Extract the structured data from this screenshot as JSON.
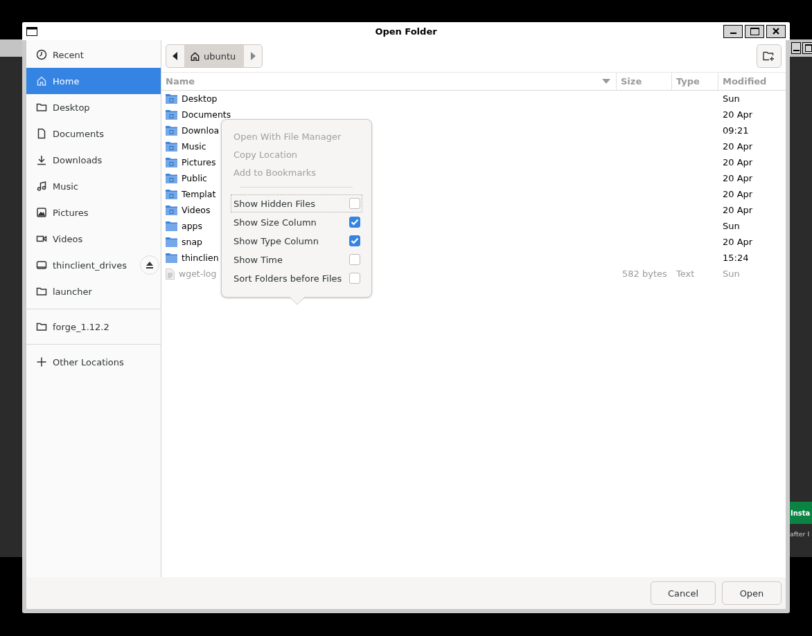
{
  "background_window": {
    "button": "Insta",
    "text": "after I"
  },
  "window": {
    "title": "Open Folder"
  },
  "sidebar": {
    "sections": [
      [
        {
          "kind": "recent",
          "label": "Recent",
          "selected": false
        },
        {
          "kind": "home",
          "label": "Home",
          "selected": true
        },
        {
          "kind": "folder",
          "label": "Desktop",
          "selected": false
        },
        {
          "kind": "document",
          "label": "Documents",
          "selected": false
        },
        {
          "kind": "download",
          "label": "Downloads",
          "selected": false
        },
        {
          "kind": "music",
          "label": "Music",
          "selected": false
        },
        {
          "kind": "picture",
          "label": "Pictures",
          "selected": false
        },
        {
          "kind": "video",
          "label": "Videos",
          "selected": false
        },
        {
          "kind": "drive",
          "label": "thinclient_drives",
          "selected": false
        },
        {
          "kind": "folder",
          "label": "launcher",
          "selected": false
        }
      ],
      [
        {
          "kind": "folder",
          "label": "forge_1.12.2",
          "selected": false
        }
      ],
      [
        {
          "kind": "other",
          "label": "Other Locations",
          "selected": false
        }
      ]
    ]
  },
  "pathbar": {
    "crumb": "ubuntu"
  },
  "table": {
    "columns": [
      "Name",
      "Size",
      "Type",
      "Modified"
    ],
    "rows": [
      {
        "kind": "special-folder",
        "name": "Desktop",
        "modified": "Sun"
      },
      {
        "kind": "special-folder",
        "name": "Documents",
        "modified": "20 Apr"
      },
      {
        "kind": "special-folder",
        "name": "Downloa",
        "modified": "09:21"
      },
      {
        "kind": "special-folder",
        "name": "Music",
        "modified": "20 Apr"
      },
      {
        "kind": "special-folder",
        "name": "Pictures",
        "modified": "20 Apr"
      },
      {
        "kind": "special-folder",
        "name": "Public",
        "modified": "20 Apr"
      },
      {
        "kind": "special-folder",
        "name": "Templat",
        "modified": "20 Apr"
      },
      {
        "kind": "special-folder",
        "name": "Videos",
        "modified": "20 Apr"
      },
      {
        "kind": "folder",
        "name": "apps",
        "modified": "Sun"
      },
      {
        "kind": "folder",
        "name": "snap",
        "modified": "20 Apr"
      },
      {
        "kind": "folder",
        "name": "thinclien",
        "modified": "15:24"
      },
      {
        "kind": "file",
        "name": "wget-log",
        "size": "582 bytes",
        "type": "Text",
        "modified": "Sun"
      }
    ]
  },
  "popover": {
    "actions": [
      {
        "label": "Open With File Manager",
        "disabled": true
      },
      {
        "label": "Copy Location",
        "disabled": true
      },
      {
        "label": "Add to Bookmarks",
        "disabled": true
      }
    ],
    "toggles": [
      {
        "label": "Show Hidden Files",
        "checked": false,
        "focused": true
      },
      {
        "label": "Show Size Column",
        "checked": true,
        "focused": false
      },
      {
        "label": "Show Type Column",
        "checked": true,
        "focused": false
      },
      {
        "label": "Show Time",
        "checked": false,
        "focused": false
      },
      {
        "label": "Sort Folders before Files",
        "checked": false,
        "focused": false
      }
    ]
  },
  "buttons": [
    "Cancel",
    "Open"
  ]
}
